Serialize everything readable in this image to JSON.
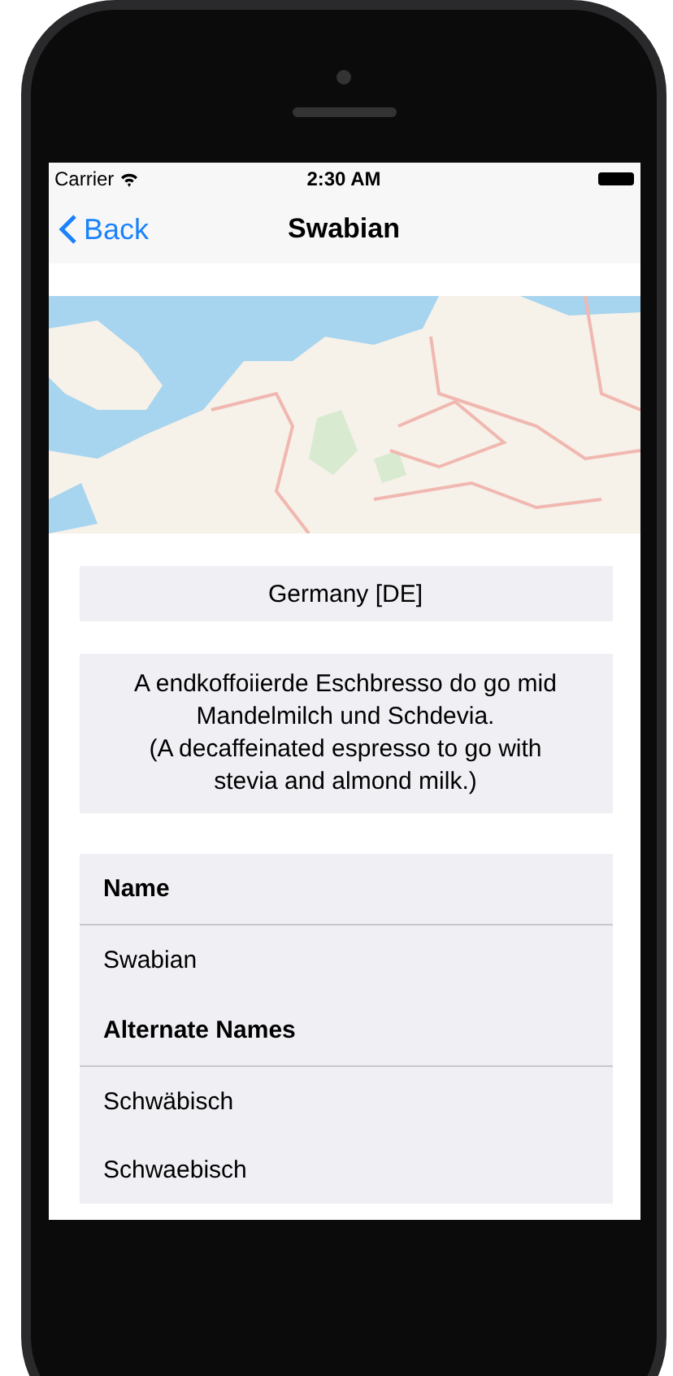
{
  "status_bar": {
    "carrier": "Carrier",
    "time": "2:30 AM"
  },
  "nav_bar": {
    "back": "Back",
    "title": "Swabian"
  },
  "country": "Germany [DE]",
  "description": [
    "A endkoffoiierde Eschbresso do go mid Mandelmilch und Schdevia.",
    "(A decaffeinated espresso to go with stevia and almond milk.)"
  ],
  "sections": [
    {
      "header": "Name",
      "items": [
        "Swabian"
      ]
    },
    {
      "header": "Alternate Names",
      "items": [
        "Schwäbisch",
        "Schwaebisch"
      ]
    }
  ]
}
